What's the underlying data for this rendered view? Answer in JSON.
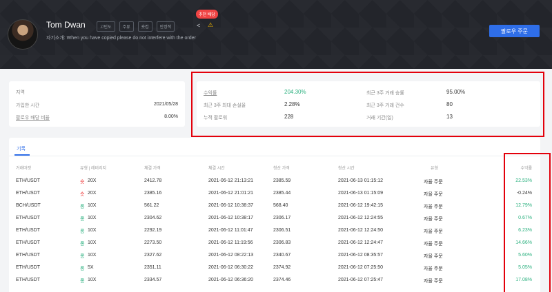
{
  "profile": {
    "name": "Tom Dwan",
    "tags": [
      "고빈도",
      "주류",
      "숏컵",
      "안정적"
    ],
    "bio": "자기소개: When you have copied please do not interfere with the order",
    "recommend_badge": "추천 배당",
    "share_icon": "share-icon",
    "warn_icon": "warning-icon",
    "follow_button": "팔로우 주문"
  },
  "info": {
    "region_label": "지역",
    "region_value": "",
    "joined_label": "가입한 시간",
    "joined_value": "2021/05/28",
    "follow_ratio_label": "팔로우 배당 비율",
    "follow_ratio_value": "8.00%"
  },
  "stats": {
    "yield_label": "수익률",
    "yield_value": "204.30%",
    "recent_win_label": "최근 3주 거래 승률",
    "recent_win_value": "95.00%",
    "max_loss_label": "최근 3주 최대 손실율",
    "max_loss_value": "2.28%",
    "recent_count_label": "최근 3주 거래 건수",
    "recent_count_value": "80",
    "followers_label": "누적 팔로워",
    "followers_value": "228",
    "period_label": "거래 기간(일)",
    "period_value": "13"
  },
  "records": {
    "tab": "기록",
    "headers": [
      "거래마켓",
      "유형 | 레버리지",
      "체결 가격",
      "체결 시간",
      "청산 가격",
      "청산 시간",
      "유형",
      "수익률"
    ],
    "rows": [
      {
        "market": "ETH/USDT",
        "dir": "숏",
        "lev": "20X",
        "open_price": "2412.78",
        "open_time": "2021-06-12 21:13:21",
        "close_price": "2385.59",
        "close_time": "2021-06-13 01:15:12",
        "type": "자율 주문",
        "profit": "22.53%"
      },
      {
        "market": "ETH/USDT",
        "dir": "숏",
        "lev": "20X",
        "open_price": "2385.16",
        "open_time": "2021-06-12 21:01:21",
        "close_price": "2385.44",
        "close_time": "2021-06-13 01:15:09",
        "type": "자율 주문",
        "profit": "-0.24%"
      },
      {
        "market": "BCH/USDT",
        "dir": "롱",
        "lev": "10X",
        "open_price": "561.22",
        "open_time": "2021-06-12 10:38:37",
        "close_price": "568.40",
        "close_time": "2021-06-12 19:42:15",
        "type": "자율 주문",
        "profit": "12.79%"
      },
      {
        "market": "ETH/USDT",
        "dir": "롱",
        "lev": "10X",
        "open_price": "2304.62",
        "open_time": "2021-06-12 10:38:17",
        "close_price": "2306.17",
        "close_time": "2021-06-12 12:24:55",
        "type": "자율 주문",
        "profit": "0.67%"
      },
      {
        "market": "ETH/USDT",
        "dir": "롱",
        "lev": "10X",
        "open_price": "2292.19",
        "open_time": "2021-06-12 11:01:47",
        "close_price": "2306.51",
        "close_time": "2021-06-12 12:24:50",
        "type": "자율 주문",
        "profit": "6.23%"
      },
      {
        "market": "ETH/USDT",
        "dir": "롱",
        "lev": "10X",
        "open_price": "2273.50",
        "open_time": "2021-06-12 11:19:56",
        "close_price": "2306.83",
        "close_time": "2021-06-12 12:24:47",
        "type": "자율 주문",
        "profit": "14.66%"
      },
      {
        "market": "ETH/USDT",
        "dir": "롱",
        "lev": "10X",
        "open_price": "2327.62",
        "open_time": "2021-06-12 08:22:13",
        "close_price": "2340.67",
        "close_time": "2021-06-12 08:35:57",
        "type": "자율 주문",
        "profit": "5.60%"
      },
      {
        "market": "ETH/USDT",
        "dir": "롱",
        "lev": "5X",
        "open_price": "2351.11",
        "open_time": "2021-06-12 06:30:22",
        "close_price": "2374.92",
        "close_time": "2021-06-12 07:25:50",
        "type": "자율 주문",
        "profit": "5.05%"
      },
      {
        "market": "ETH/USDT",
        "dir": "롱",
        "lev": "10X",
        "open_price": "2334.57",
        "open_time": "2021-06-12 06:36:20",
        "close_price": "2374.46",
        "close_time": "2021-06-12 07:25:47",
        "type": "자율 주문",
        "profit": "17.08%"
      }
    ]
  },
  "colors": {
    "accent": "#2f6ee8",
    "positive": "#2bb07f",
    "negative": "#ef4444",
    "highlight_box": "#e3000b"
  }
}
